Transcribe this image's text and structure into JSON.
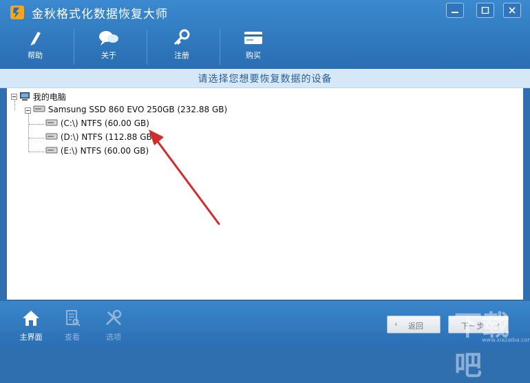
{
  "window": {
    "title": "金秋格式化数据恢复大师"
  },
  "toolbar": {
    "items": [
      {
        "label": "帮助"
      },
      {
        "label": "关于"
      },
      {
        "label": "注册"
      },
      {
        "label": "购买"
      }
    ]
  },
  "header": {
    "prompt": "请选择您想要恢复数据的设备"
  },
  "tree": {
    "root": "我的电脑",
    "disk": "Samsung SSD 860 EVO 250GB (232.88 GB)",
    "partitions": [
      {
        "label": "(C:\\) NTFS (60.00 GB)"
      },
      {
        "label": "(D:\\) NTFS (112.88 GB)"
      },
      {
        "label": "(E:\\) NTFS (60.00 GB)"
      }
    ]
  },
  "bottom_nav": {
    "home": "主界面",
    "view": "查看",
    "options": "选项"
  },
  "buttons": {
    "back": "返回",
    "next": "下一步"
  },
  "watermark": {
    "text": "下载吧",
    "url_text": "www.xiazaiba.com"
  },
  "colors": {
    "accent": "#2f6fb0",
    "header_strip": "#d6e8f7",
    "arrow": "#d42a2a"
  }
}
